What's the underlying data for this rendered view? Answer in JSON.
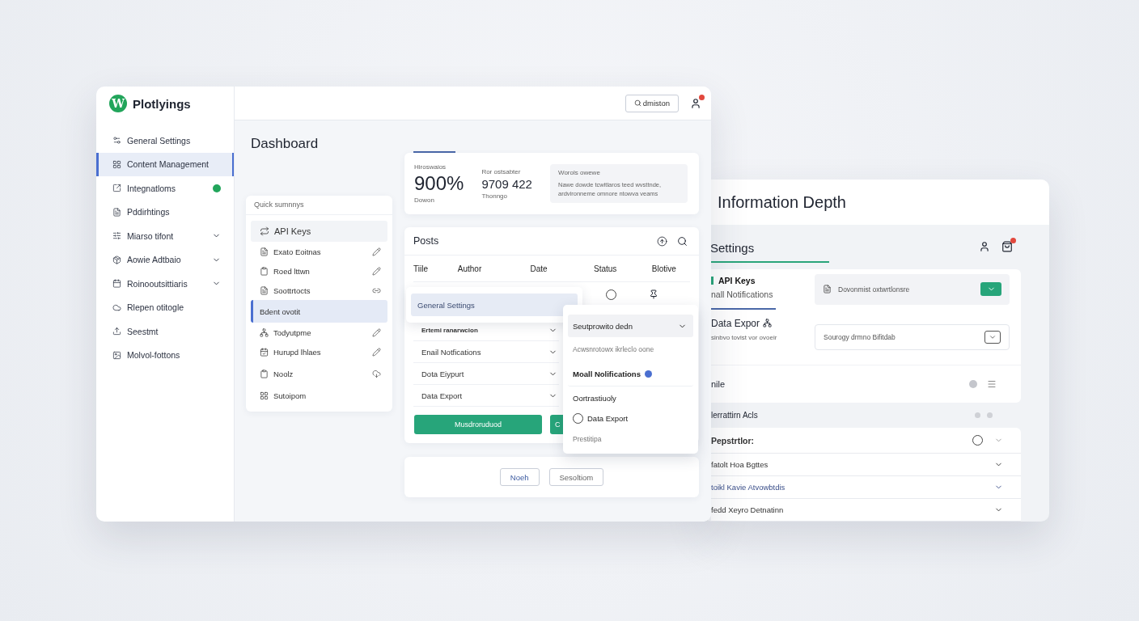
{
  "main_window": {
    "sidebar": {
      "logo_mark": "W",
      "brand": "Plotlyings",
      "items": [
        {
          "label": "General Settings",
          "selected": false,
          "expandable": false,
          "badge": false
        },
        {
          "label": "Content Management",
          "selected": true,
          "expandable": false,
          "badge": false
        },
        {
          "label": "Integnatloms",
          "selected": false,
          "expandable": false,
          "badge": true
        },
        {
          "label": "Pddirhtings",
          "selected": false,
          "expandable": false,
          "badge": false
        },
        {
          "label": "Miarso tifont",
          "selected": false,
          "expandable": true,
          "badge": false
        },
        {
          "label": "Aowie Adtbaio",
          "selected": false,
          "expandable": true,
          "badge": false
        },
        {
          "label": "Roinooutsittiaris",
          "selected": false,
          "expandable": true,
          "badge": false
        },
        {
          "label": "Rlepen otitogle",
          "selected": false,
          "expandable": false,
          "badge": false
        },
        {
          "label": "Seestmt",
          "selected": false,
          "expandable": false,
          "badge": false
        },
        {
          "label": "Molvol-fottons",
          "selected": false,
          "expandable": false,
          "badge": false
        }
      ]
    },
    "topbar": {
      "search_button": "dmiston",
      "notification": true
    },
    "title": "Dashboard",
    "quick_summary": {
      "title": "Quick sumnnys",
      "items": [
        {
          "kind": "heading",
          "label": "API Keys",
          "selected": false
        },
        {
          "kind": "row",
          "label": "Exato Eoitnas",
          "selected": false
        },
        {
          "kind": "row",
          "label": "Roed lttwn",
          "selected": false
        },
        {
          "kind": "row",
          "label": "Soottrtocts",
          "selected": false
        },
        {
          "kind": "plain",
          "label": "Bdent ovotit",
          "selected": true
        },
        {
          "kind": "row",
          "label": "Todyutpme",
          "selected": false
        },
        {
          "kind": "row",
          "label": "Hurupd lhlaes",
          "selected": false
        },
        {
          "kind": "row",
          "label": "Noolz",
          "selected": false
        },
        {
          "kind": "row",
          "label": "Sutoipom",
          "selected": false
        }
      ]
    },
    "stats": {
      "tab_active": true,
      "items": [
        {
          "label": "Hiroswaios",
          "value": "900%",
          "caption": "Dowon",
          "large": true
        },
        {
          "label": "Ror ostsabter",
          "value": "9709 422",
          "caption": "Thonngo",
          "large": false
        }
      ],
      "note": {
        "title": "Worols owewe",
        "text": "Nawe dowde tcwitlaros teed wvsttnde, ardvironneme omnore ntowva veams"
      }
    },
    "posts": {
      "title": "Posts",
      "columns": [
        "Tiile",
        "Author",
        "Date",
        "Status",
        "Blotive"
      ],
      "blurred_row": {
        "radio_selected": false
      },
      "rows": [
        "Ertemi ranarwcion",
        "Enail Notfications",
        "Dota Eiypurt",
        "Data Export"
      ],
      "buttons": [
        "Musdroruduod",
        "C"
      ]
    },
    "dropdown": {
      "label": "General Settings"
    },
    "popover": {
      "items": [
        {
          "kind": "select",
          "label": "Seutprowito dedn"
        },
        {
          "kind": "hint",
          "label": "Acwsnrotowx ikrleclo oone"
        },
        {
          "kind": "toggle",
          "label": "Moall Nolifications",
          "on": true
        },
        {
          "kind": "label",
          "label": "Oortrastiuoly"
        },
        {
          "kind": "radio",
          "label": "Data Export",
          "selected": false
        },
        {
          "kind": "hint",
          "label": "Prestitipa"
        }
      ]
    },
    "footer_buttons": [
      "Noeh",
      "Sesoltiom"
    ]
  },
  "side_window": {
    "title": "Information Depth",
    "settings_title": "Settings",
    "cart_badge": true,
    "tabs": [
      {
        "label": "API Keys",
        "selected": true
      },
      {
        "label": "nall Notifications",
        "selected": false
      }
    ],
    "section": {
      "label": "Data Expor",
      "caption": "sinbvo tovist vor ovoeir"
    },
    "fields": [
      {
        "kind": "action",
        "value": "Dovonmist oxtwrtlonsre"
      },
      {
        "kind": "select",
        "value": "Sourogy drmno Bifitdab"
      }
    ],
    "row": "nile",
    "group_label": "lerrattirn Acls",
    "list": {
      "title": "Pepstrtlor:",
      "radio_selected": false,
      "rows": [
        {
          "label": "fatolt Hoa Bgttes",
          "highlighted": false
        },
        {
          "label": "toikl Kavie Atvowbtdis",
          "highlighted": true
        },
        {
          "label": "fedd Xeyro Detnatinn",
          "highlighted": false
        }
      ]
    }
  }
}
